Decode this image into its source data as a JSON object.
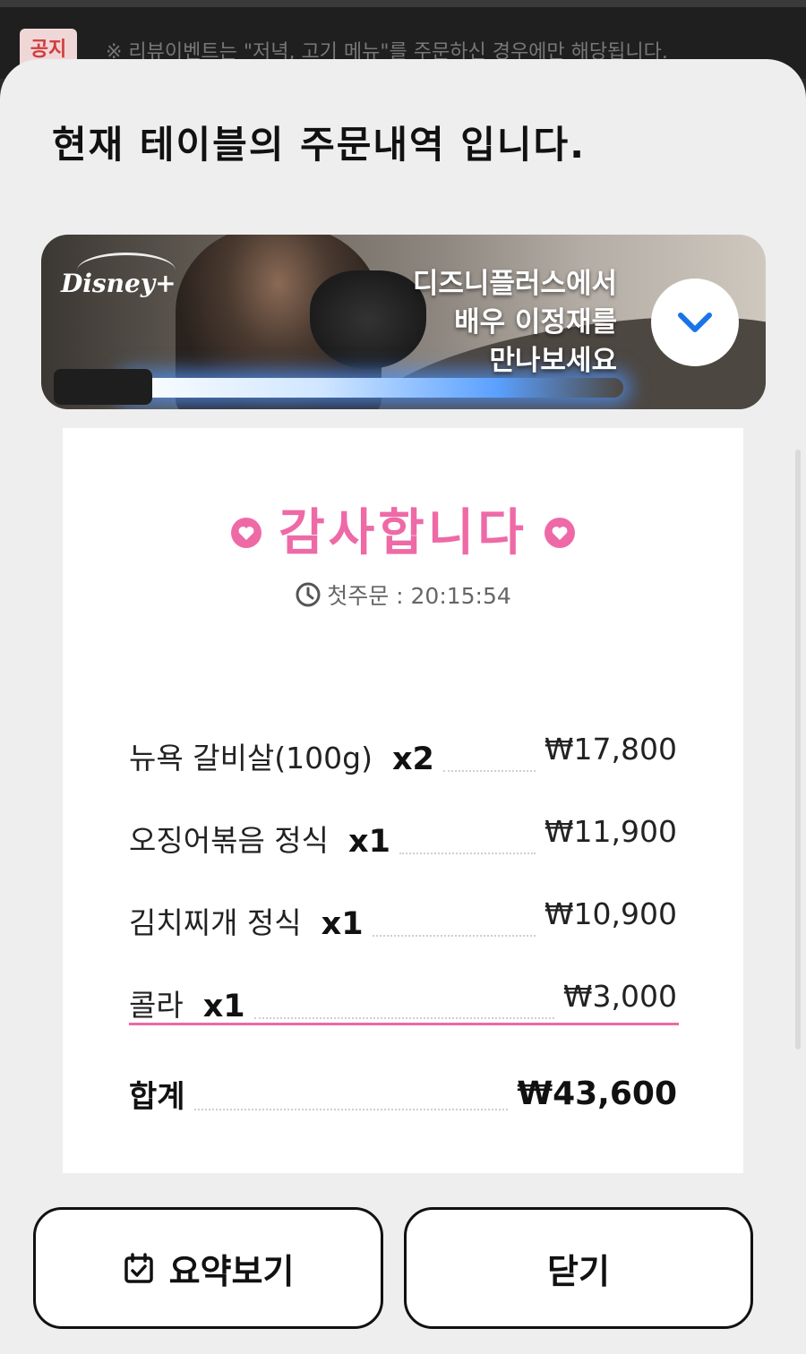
{
  "notice": {
    "badge": "공지",
    "text": "※ 리뷰이벤트는 \"저녁, 고기 메뉴\"를 주문하신 경우에만 해당됩니다."
  },
  "sheet": {
    "title": "현재 테이블의 주문내역 입니다."
  },
  "banner": {
    "logo": "Disney+",
    "headline_lines": [
      "디즈니플러스에서",
      "배우 이정재를",
      "만나보세요"
    ],
    "expand_icon": "chevron-down-icon"
  },
  "receipt": {
    "thanks": "감사합니다",
    "first_order_label": "첫주문 : ",
    "first_order_time": "20:15:54",
    "items": [
      {
        "name": "뉴욕 갈비살(100g)",
        "qty": "x2",
        "price": "₩17,800"
      },
      {
        "name": "오징어볶음 정식",
        "qty": "x1",
        "price": "₩11,900"
      },
      {
        "name": "김치찌개 정식",
        "qty": "x1",
        "price": "₩10,900"
      },
      {
        "name": "콜라",
        "qty": "x1",
        "price": "₩3,000"
      }
    ],
    "total_label": "합계",
    "total_amount": "₩43,600"
  },
  "buttons": {
    "summary": "요약보기",
    "close": "닫기"
  },
  "colors": {
    "accent_pink": "#ee6aa6",
    "chevron_blue": "#1a73e8",
    "sheet_bg": "#eeeeee"
  }
}
